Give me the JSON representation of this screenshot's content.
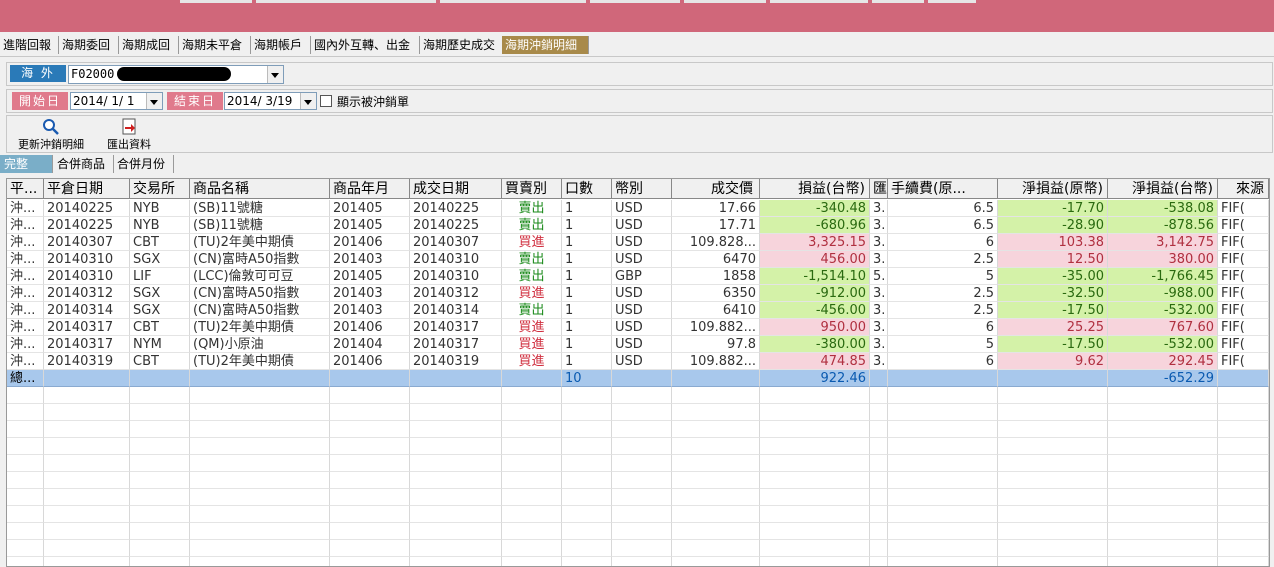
{
  "top_tabs": [
    {
      "label": "進階回報",
      "active": false
    },
    {
      "label": "海期委回",
      "active": false
    },
    {
      "label": "海期成回",
      "active": false
    },
    {
      "label": "海期未平倉",
      "active": false
    },
    {
      "label": "海期帳戶",
      "active": false
    },
    {
      "label": "國內外互轉、出金",
      "active": false
    },
    {
      "label": "海期歷史成交",
      "active": false
    },
    {
      "label": "海期沖銷明細",
      "active": true
    }
  ],
  "account": {
    "market_label": "海 外",
    "account_value": "F02000"
  },
  "date_filter": {
    "start_label": "開始日",
    "start_value": "2014/ 1/ 1",
    "end_label": "結束日",
    "end_value": "2014/ 3/19",
    "show_offset_label": "顯示被沖銷單",
    "show_offset_checked": false
  },
  "toolbar": {
    "refresh_label": "更新沖銷明細",
    "export_label": "匯出資料"
  },
  "view_tabs": [
    {
      "label": "完整",
      "active": true
    },
    {
      "label": "合併商品",
      "active": false
    },
    {
      "label": "合併月份",
      "active": false
    }
  ],
  "columns": [
    "平...",
    "平倉日期",
    "交易所",
    "商品名稱",
    "商品年月",
    "成交日期",
    "買賣別",
    "口數",
    "幣別",
    "成交價",
    "損益(台幣)",
    "匯",
    "手續費(原...",
    "淨損益(原幣)",
    "淨損益(台幣)",
    "來源"
  ],
  "rows": [
    {
      "type": "沖...",
      "close_date": "20140225",
      "exch": "NYB",
      "product": "(SB)11號糖",
      "ym": "201405",
      "trade_date": "20140225",
      "side": "賣出",
      "qty": "1",
      "cur": "USD",
      "price": "17.66",
      "pnl_twd": "-340.48",
      "fx": "3.",
      "fee": "6.5",
      "net_orig": "-17.70",
      "net_twd": "-538.08",
      "src": "FIF("
    },
    {
      "type": "沖...",
      "close_date": "20140225",
      "exch": "NYB",
      "product": "(SB)11號糖",
      "ym": "201405",
      "trade_date": "20140225",
      "side": "賣出",
      "qty": "1",
      "cur": "USD",
      "price": "17.71",
      "pnl_twd": "-680.96",
      "fx": "3.",
      "fee": "6.5",
      "net_orig": "-28.90",
      "net_twd": "-878.56",
      "src": "FIF("
    },
    {
      "type": "沖...",
      "close_date": "20140307",
      "exch": "CBT",
      "product": "(TU)2年美中期債",
      "ym": "201406",
      "trade_date": "20140307",
      "side": "買進",
      "qty": "1",
      "cur": "USD",
      "price": "109.828...",
      "pnl_twd": "3,325.15",
      "fx": "3.",
      "fee": "6",
      "net_orig": "103.38",
      "net_twd": "3,142.75",
      "src": "FIF("
    },
    {
      "type": "沖...",
      "close_date": "20140310",
      "exch": "SGX",
      "product": "(CN)富時A50指數",
      "ym": "201403",
      "trade_date": "20140310",
      "side": "賣出",
      "qty": "1",
      "cur": "USD",
      "price": "6470",
      "pnl_twd": "456.00",
      "fx": "3.",
      "fee": "2.5",
      "net_orig": "12.50",
      "net_twd": "380.00",
      "src": "FIF("
    },
    {
      "type": "沖...",
      "close_date": "20140310",
      "exch": "LIF",
      "product": "(LCC)倫敦可可豆",
      "ym": "201405",
      "trade_date": "20140310",
      "side": "賣出",
      "qty": "1",
      "cur": "GBP",
      "price": "1858",
      "pnl_twd": "-1,514.10",
      "fx": "5.",
      "fee": "5",
      "net_orig": "-35.00",
      "net_twd": "-1,766.45",
      "src": "FIF("
    },
    {
      "type": "沖...",
      "close_date": "20140312",
      "exch": "SGX",
      "product": "(CN)富時A50指數",
      "ym": "201403",
      "trade_date": "20140312",
      "side": "買進",
      "qty": "1",
      "cur": "USD",
      "price": "6350",
      "pnl_twd": "-912.00",
      "fx": "3.",
      "fee": "2.5",
      "net_orig": "-32.50",
      "net_twd": "-988.00",
      "src": "FIF("
    },
    {
      "type": "沖...",
      "close_date": "20140314",
      "exch": "SGX",
      "product": "(CN)富時A50指數",
      "ym": "201403",
      "trade_date": "20140314",
      "side": "賣出",
      "qty": "1",
      "cur": "USD",
      "price": "6410",
      "pnl_twd": "-456.00",
      "fx": "3.",
      "fee": "2.5",
      "net_orig": "-17.50",
      "net_twd": "-532.00",
      "src": "FIF("
    },
    {
      "type": "沖...",
      "close_date": "20140317",
      "exch": "CBT",
      "product": "(TU)2年美中期債",
      "ym": "201406",
      "trade_date": "20140317",
      "side": "買進",
      "qty": "1",
      "cur": "USD",
      "price": "109.882...",
      "pnl_twd": "950.00",
      "fx": "3.",
      "fee": "6",
      "net_orig": "25.25",
      "net_twd": "767.60",
      "src": "FIF("
    },
    {
      "type": "沖...",
      "close_date": "20140317",
      "exch": "NYM",
      "product": "(QM)小原油",
      "ym": "201404",
      "trade_date": "20140317",
      "side": "買進",
      "qty": "1",
      "cur": "USD",
      "price": "97.8",
      "pnl_twd": "-380.00",
      "fx": "3.",
      "fee": "5",
      "net_orig": "-17.50",
      "net_twd": "-532.00",
      "src": "FIF("
    },
    {
      "type": "沖...",
      "close_date": "20140319",
      "exch": "CBT",
      "product": "(TU)2年美中期債",
      "ym": "201406",
      "trade_date": "20140319",
      "side": "買進",
      "qty": "1",
      "cur": "USD",
      "price": "109.882...",
      "pnl_twd": "474.85",
      "fx": "3.",
      "fee": "6",
      "net_orig": "9.62",
      "net_twd": "292.45",
      "src": "FIF("
    }
  ],
  "total": {
    "label": "總...",
    "qty": "10",
    "pnl_twd": "922.46",
    "net_twd": "-652.29"
  }
}
